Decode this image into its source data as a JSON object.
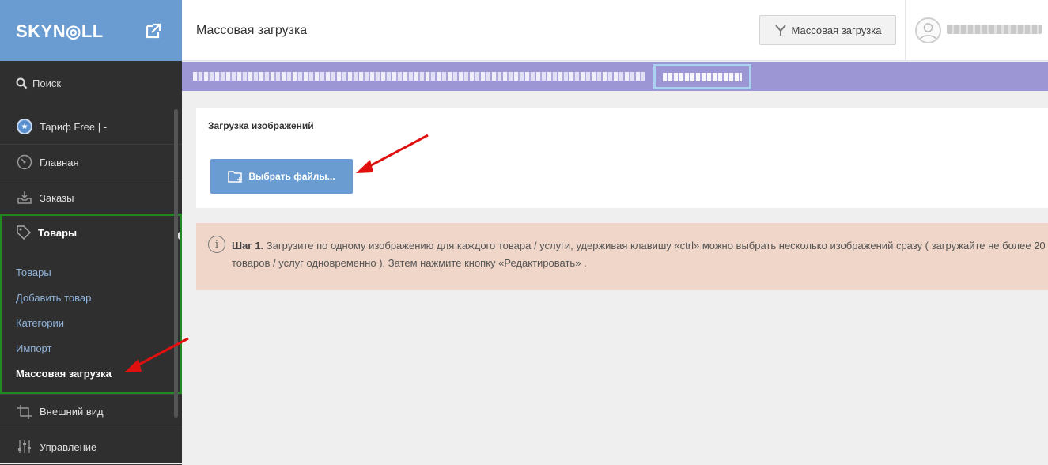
{
  "sidebar": {
    "logo": "SKYN◎LL",
    "search_label": "Поиск",
    "tariff_label": "Тариф Free | -",
    "items": [
      {
        "label": "Главная",
        "icon": "gauge-icon"
      },
      {
        "label": "Заказы",
        "icon": "inbox-download-icon"
      },
      {
        "label": "Товары",
        "icon": "tag-icon"
      },
      {
        "label": "Внешний вид",
        "icon": "crop-icon"
      },
      {
        "label": "Управление",
        "icon": "sliders-icon"
      }
    ],
    "sub_items": [
      {
        "label": "Товары"
      },
      {
        "label": "Добавить товар"
      },
      {
        "label": "Категории"
      },
      {
        "label": "Импорт"
      },
      {
        "label": "Массовая загрузка"
      }
    ]
  },
  "header": {
    "title": "Массовая загрузка",
    "button_label": "Массовая загрузка"
  },
  "main": {
    "card_title": "Загрузка изображений",
    "choose_button": "Выбрать файлы...",
    "info_step": "Шаг 1.",
    "info_text": " Загрузите по одному изображению для каждого товара / услуги, удерживая клавишу «ctrl» можно выбрать несколько изображений сразу ( загружайте не более 20 товаров / услуг одновременно ). Затем нажмите кнопку «Редактировать» ."
  },
  "colors": {
    "accent": "#6a9cd1",
    "sidebar_bg": "#2f2f2f",
    "highlight_box": "#1f8a1f",
    "annotation_arrow": "#e01010",
    "info_bg": "#f0d6c8",
    "banner_bg": "#9c97d4"
  }
}
